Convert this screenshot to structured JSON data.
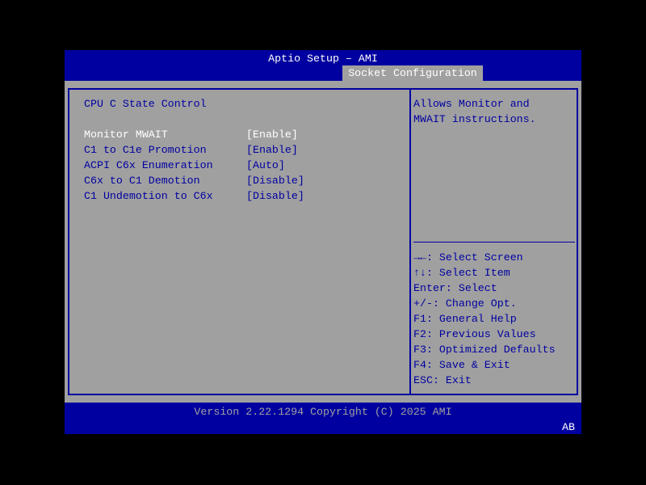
{
  "header": {
    "title": "Aptio Setup – AMI",
    "active_tab": "Socket Configuration"
  },
  "main": {
    "section_title": "CPU C State Control",
    "items": [
      {
        "label": "Monitor MWAIT",
        "value": "[Enable]",
        "selected": true
      },
      {
        "label": "C1 to C1e Promotion",
        "value": "[Enable]"
      },
      {
        "label": "ACPI C6x Enumeration",
        "value": "[Auto]"
      },
      {
        "label": "C6x to C1 Demotion",
        "value": "[Disable]"
      },
      {
        "label": "C1 Undemotion to C6x",
        "value": "[Disable]"
      }
    ]
  },
  "help": {
    "description": [
      "Allows Monitor and",
      "MWAIT instructions."
    ],
    "keys": [
      "→←: Select Screen",
      "↑↓: Select Item",
      "Enter: Select",
      "+/-: Change Opt.",
      "F1: General Help",
      "F2: Previous Values",
      "F3: Optimized Defaults",
      "F4: Save & Exit",
      "ESC: Exit"
    ]
  },
  "footer": {
    "version": "Version 2.22.1294 Copyright (C) 2025 AMI",
    "badge": "AB"
  }
}
